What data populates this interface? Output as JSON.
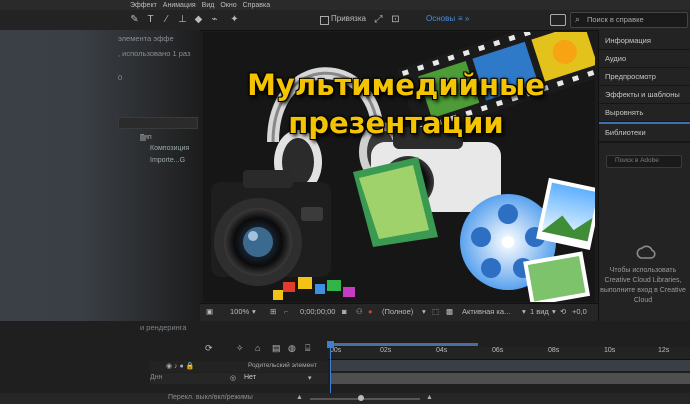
{
  "menu": {
    "items": [
      "Эффект",
      "Анимация",
      "Вид",
      "Окно",
      "Справка"
    ]
  },
  "toolbar": {
    "snap_label": "Привязка",
    "workspace_label": "Основы",
    "workspace_menu": "≡ »",
    "search_placeholder": "Поиск в справке"
  },
  "left_panel": {
    "line1": "элемента эффе",
    "line2": ", использовано 1 раз",
    "line3": "0",
    "col_header": "Тип",
    "row1": "Композиция",
    "row2": "Importe...G"
  },
  "headline": {
    "line1": "Мультимедийные",
    "line2": "презентации"
  },
  "right_panel": {
    "items": [
      "Информация",
      "Аудио",
      "Предпросмотр",
      "Эффекты и шаблоны",
      "Выровнять",
      "Библиотеки"
    ],
    "lib_search": "Поиск в Adobe",
    "cc_text": "Чтобы использовать Creative Cloud Libraries, выполните вход в Creative Cloud"
  },
  "viewer_bar": {
    "zoom": "100%",
    "timecode": "0;00;00;00",
    "resolution": "(Полное)",
    "camera": "Активная ка...",
    "views": "1 вид",
    "offset": "+0,0"
  },
  "timeline": {
    "title": "и рендеринга",
    "ruler": [
      "00s",
      "02s",
      "04s",
      "06s",
      "08s",
      "10s",
      "12s"
    ],
    "parent_header": "Родительский элемент",
    "parent_value": "Нет",
    "layer_label": "Днн",
    "status": "Перекл. выкл/вкл/режимы"
  },
  "colors": {
    "accent": "#3e7fd0",
    "headline": "#f4c400",
    "panel_bg": "#232323"
  }
}
